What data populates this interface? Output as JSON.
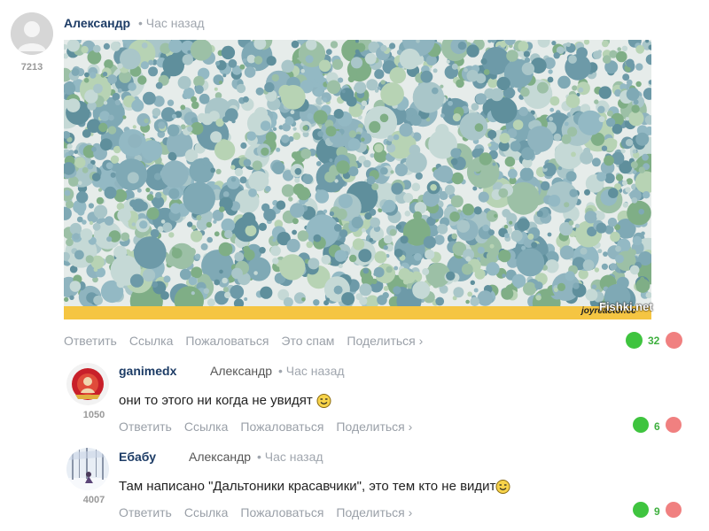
{
  "comments": [
    {
      "author": "Александр",
      "time": "• Час назад",
      "karma": "7213",
      "image": {
        "watermark": "Fishki.net",
        "caption": "joyreactor.cc"
      },
      "actions": [
        "Ответить",
        "Ссылка",
        "Пожаловаться",
        "Это спам",
        "Поделиться ›"
      ],
      "score": "32"
    },
    {
      "author": "ganimedx",
      "reply_to": "Александр",
      "time": "• Час назад",
      "karma": "1050",
      "text": "они то этого ни когда не увидят",
      "actions": [
        "Ответить",
        "Ссылка",
        "Пожаловаться",
        "Поделиться ›"
      ],
      "score": "6"
    },
    {
      "author": "Ебабу",
      "reply_to": "Александр",
      "time": "• Час назад",
      "karma": "4007",
      "text": "Там написано \"Дальтоники красавчики\", это тем кто не видит",
      "actions": [
        "Ответить",
        "Ссылка",
        "Пожаловаться",
        "Поделиться ›"
      ],
      "score": "9"
    }
  ],
  "colors": {
    "author": "#1d3c66",
    "muted": "#9aa0a8",
    "vote_up": "#3fc43f",
    "vote_down": "#f08080",
    "score": "#3fb03f",
    "image_bar": "#f5c542"
  }
}
